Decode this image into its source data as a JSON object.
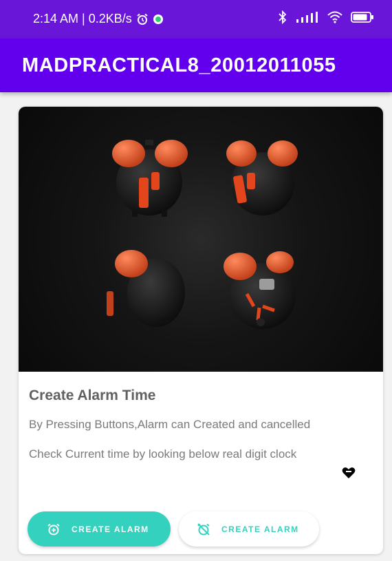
{
  "status_bar": {
    "time_info": "2:14 AM | 0.2KB/s",
    "icons": [
      "alarm-icon",
      "app-status-icon",
      "bluetooth-icon",
      "signal-icon",
      "wifi-icon",
      "battery-icon"
    ]
  },
  "app_bar": {
    "title": "MADPRACTICAL8_20012011055"
  },
  "card": {
    "image": "alarm-clocks-image",
    "title": "Create Alarm Time",
    "description_line1": "By Pressing Buttons,Alarm can Created and cancelled",
    "description_line2": "Check Current time by looking below real digit clock",
    "buttons": {
      "create_label": "CREATE ALARM",
      "cancel_label": "CREATE ALARM"
    }
  },
  "colors": {
    "status_bar": "#6a16d9",
    "app_bar": "#6200ee",
    "accent": "#34d1bf"
  }
}
